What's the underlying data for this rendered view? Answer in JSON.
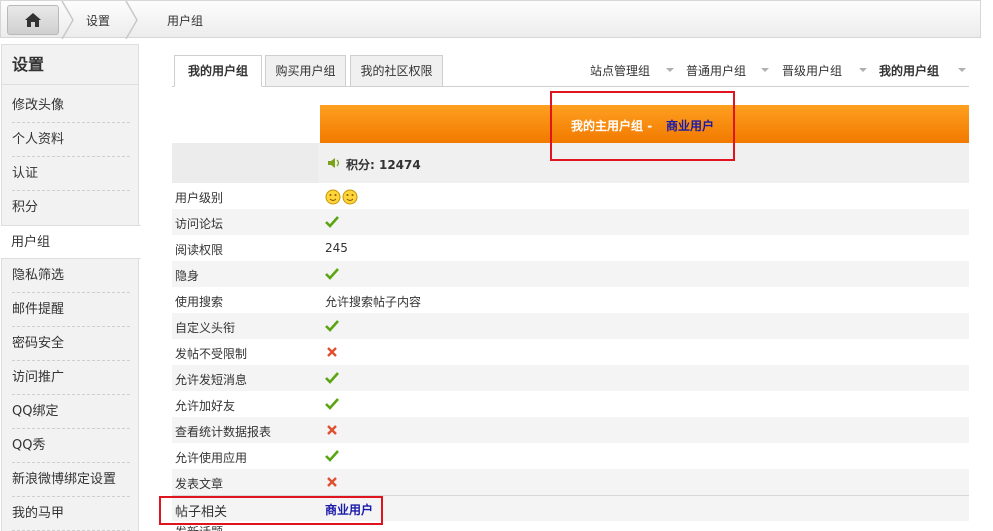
{
  "breadcrumb": {
    "level1": "设置",
    "level2": "用户组"
  },
  "sidebar": {
    "title": "设置",
    "items": [
      {
        "label": "修改头像",
        "active": false
      },
      {
        "label": "个人资料",
        "active": false
      },
      {
        "label": "认证",
        "active": false
      },
      {
        "label": "积分",
        "active": false
      },
      {
        "label": "用户组",
        "active": true
      },
      {
        "label": "隐私筛选",
        "active": false
      },
      {
        "label": "邮件提醒",
        "active": false
      },
      {
        "label": "密码安全",
        "active": false
      },
      {
        "label": "访问推广",
        "active": false
      },
      {
        "label": "QQ绑定",
        "active": false
      },
      {
        "label": "QQ秀",
        "active": false
      },
      {
        "label": "新浪微博绑定设置",
        "active": false
      },
      {
        "label": "我的马甲",
        "active": false
      }
    ]
  },
  "tabs": [
    {
      "label": "我的用户组",
      "active": true
    },
    {
      "label": "购买用户组",
      "active": false
    },
    {
      "label": "我的社区权限",
      "active": false
    }
  ],
  "group_links": [
    {
      "label": "站点管理组",
      "bold": false
    },
    {
      "label": "普通用户组",
      "bold": false
    },
    {
      "label": "晋级用户组",
      "bold": false
    },
    {
      "label": "我的用户组",
      "bold": true
    }
  ],
  "main_group": {
    "label": "我的主用户组",
    "separator": "-",
    "value": "商业用户"
  },
  "score": {
    "text": "积分: 12474"
  },
  "permissions": [
    {
      "label": "用户级别",
      "type": "level",
      "value": ""
    },
    {
      "label": "访问论坛",
      "type": "yes",
      "value": ""
    },
    {
      "label": "阅读权限",
      "type": "text",
      "value": "245"
    },
    {
      "label": "隐身",
      "type": "yes",
      "value": ""
    },
    {
      "label": "使用搜索",
      "type": "text",
      "value": "允许搜索帖子内容"
    },
    {
      "label": "自定义头衔",
      "type": "yes",
      "value": ""
    },
    {
      "label": "发帖不受限制",
      "type": "no",
      "value": ""
    },
    {
      "label": "允许发短消息",
      "type": "yes",
      "value": ""
    },
    {
      "label": "允许加好友",
      "type": "yes",
      "value": ""
    },
    {
      "label": "查看统计数据报表",
      "type": "no",
      "value": ""
    },
    {
      "label": "允许使用应用",
      "type": "yes",
      "value": ""
    },
    {
      "label": "发表文章",
      "type": "no",
      "value": ""
    }
  ],
  "section": {
    "label": "帖子相关",
    "value": "商业用户"
  },
  "partial_row": {
    "label": "发新话题"
  },
  "icons": {
    "yes": "check-icon",
    "no": "cross-icon",
    "level": "smiley-icon",
    "home": "home-icon",
    "speaker": "speaker-icon"
  },
  "colors": {
    "accent_orange": "#f17a00",
    "link_blue": "#1a1aa8",
    "check_green": "#5aa512",
    "cross_red": "#e05030",
    "highlight_red": "#e0141e"
  }
}
